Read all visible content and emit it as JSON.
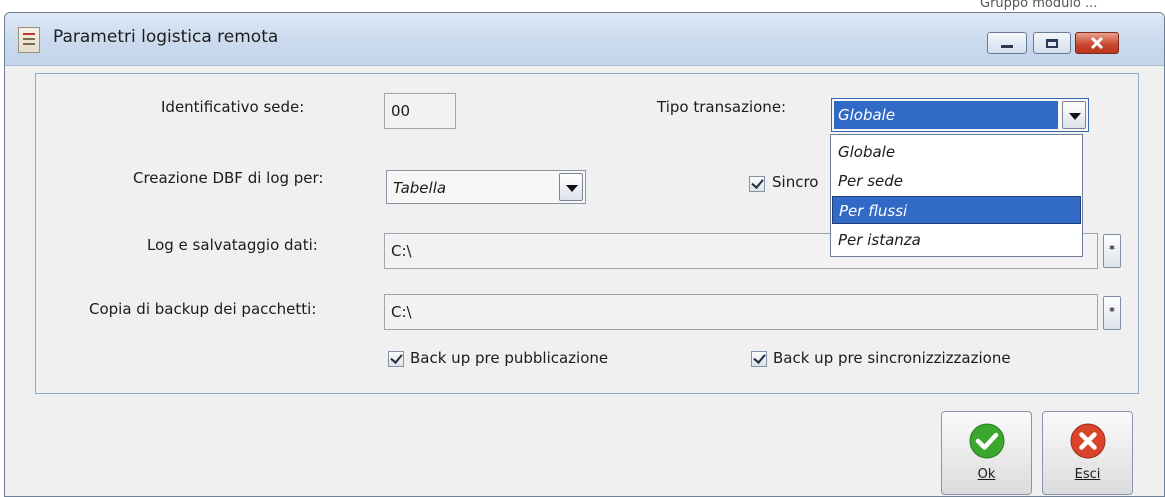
{
  "background_text": "Gruppo modulo ...",
  "window": {
    "title": "Parametri logistica remota",
    "app_icon": "document-icon"
  },
  "form": {
    "identificativo_label": "Identificativo sede:",
    "identificativo_value": "00",
    "tipo_transazione_label": "Tipo transazione:",
    "tipo_transazione_value": "Globale",
    "tipo_transazione_options": [
      "Globale",
      "Per sede",
      "Per flussi",
      "Per istanza"
    ],
    "highlighted_option": "Per flussi",
    "creazione_label": "Creazione DBF di log per:",
    "creazione_value": "Tabella",
    "sincro_label": "Sincro",
    "log_label": "Log e salvataggio dati:",
    "log_value": "C:\\",
    "copia_label": "Copia di backup dei pacchetti:",
    "copia_value": "C:\\",
    "backup_pre_pub_label": "Back up pre pubblicazione",
    "backup_pre_sinc_label": "Back up pre sincronizzizzazione",
    "browse_glyph": "*"
  },
  "buttons": {
    "ok_label": "Ok",
    "esci_label": "Esci"
  },
  "colors": {
    "highlight": "#3169c6",
    "ok_green": "#3aa82c",
    "esci_red": "#d9442b"
  }
}
